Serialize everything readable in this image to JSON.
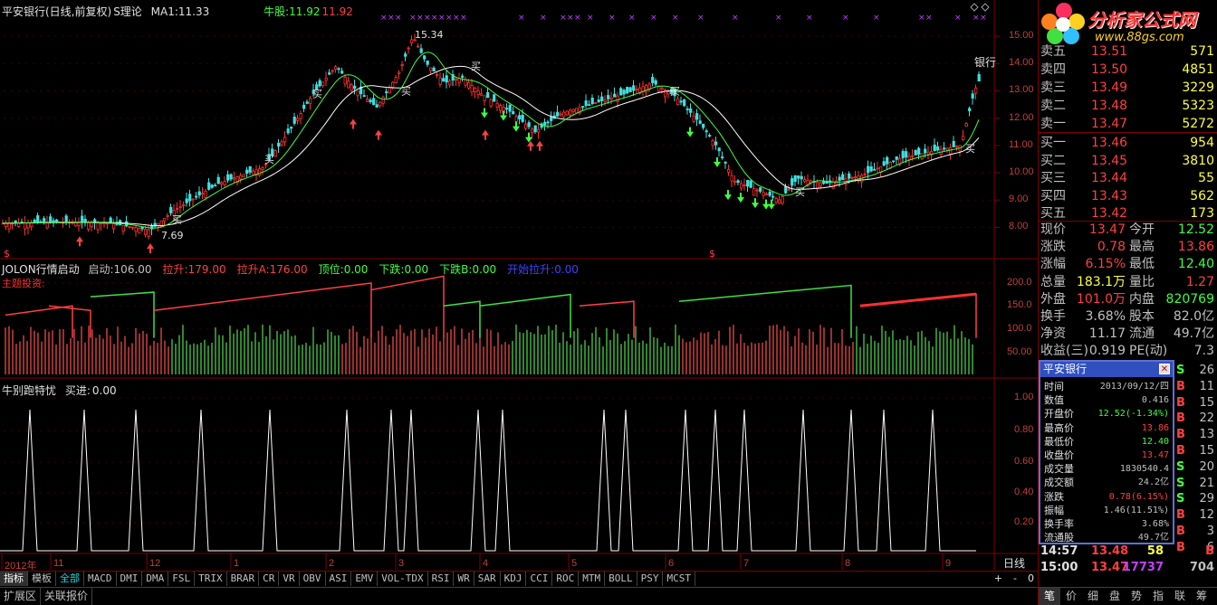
{
  "header": {
    "stock": "平安银行(日线,前复权)",
    "formula": "S理论",
    "ma_label": "MA1:",
    "ma_value": "11.33",
    "bull_label": "牛股:",
    "bull_v1": "11.92",
    "bull_v2": "11.92"
  },
  "price_axis": [
    "15.00",
    "14.00",
    "13.00",
    "12.00",
    "11.00",
    "10.00",
    "9.00",
    "8.00"
  ],
  "price_annotations": {
    "high": "15.34",
    "low": "7.69",
    "side": "银行",
    "buy": "买"
  },
  "indicator1": {
    "title": "JOLON行情启动",
    "items": [
      {
        "label": "启动:",
        "value": "106.00",
        "color": "#c0c0c0"
      },
      {
        "label": "拉升:",
        "value": "179.00",
        "color": "#ff4040"
      },
      {
        "label": "拉升A:",
        "value": "176.00",
        "color": "#ff4040"
      },
      {
        "label": "顶位:",
        "value": "0.00",
        "color": "#40ff40"
      },
      {
        "label": "下跌:",
        "value": "0.00",
        "color": "#40ff40"
      },
      {
        "label": "下跌B:",
        "value": "0.00",
        "color": "#40ff40"
      },
      {
        "label": "开始拉升:",
        "value": "0.00",
        "color": "#4040ff"
      }
    ],
    "sub": "主题投资:",
    "axis": [
      "200.0",
      "150.0",
      "100.0",
      "50.00"
    ]
  },
  "indicator2": {
    "title": "牛别跑特忧",
    "item_label": "买进:",
    "item_value": "0.00",
    "axis": [
      "1.00",
      "0.80",
      "0.60",
      "0.40",
      "0.20"
    ]
  },
  "dates": [
    "2012年",
    "11",
    "12",
    "1",
    "2",
    "3",
    "4",
    "5",
    "6",
    "7",
    "8",
    "9"
  ],
  "period": "日线",
  "zoom": {
    "plus": "+",
    "minus": "-",
    "zero": "0"
  },
  "tabs": [
    "指标",
    "模板",
    "全部",
    "MACD",
    "DMI",
    "DMA",
    "FSL",
    "TRIX",
    "BRAR",
    "CR",
    "VR",
    "OBV",
    "ASI",
    "EMV",
    "VOL-TDX",
    "RSI",
    "WR",
    "SAR",
    "KDJ",
    "CCI",
    "ROC",
    "MTM",
    "BOLL",
    "PSY",
    "MCST"
  ],
  "bottom_tabs": [
    "扩展区",
    "关联报价"
  ],
  "logo": {
    "text": "分析家公式网",
    "url": "www.88gs.com"
  },
  "sell_orders": [
    {
      "label": "卖五",
      "price": "13.51",
      "vol": "571"
    },
    {
      "label": "卖四",
      "price": "13.50",
      "vol": "4851"
    },
    {
      "label": "卖三",
      "price": "13.49",
      "vol": "3229"
    },
    {
      "label": "卖二",
      "price": "13.48",
      "vol": "5323"
    },
    {
      "label": "卖一",
      "price": "13.47",
      "vol": "5272"
    }
  ],
  "buy_orders": [
    {
      "label": "买一",
      "price": "13.46",
      "vol": "954"
    },
    {
      "label": "买二",
      "price": "13.45",
      "vol": "3810"
    },
    {
      "label": "买三",
      "price": "13.44",
      "vol": "55"
    },
    {
      "label": "买四",
      "price": "13.43",
      "vol": "562"
    },
    {
      "label": "买五",
      "price": "13.42",
      "vol": "173"
    }
  ],
  "quote": [
    {
      "l1": "现价",
      "v1": "13.47",
      "c1": "#ff4040",
      "l2": "今开",
      "v2": "12.52",
      "c2": "#40ff40"
    },
    {
      "l1": "涨跌",
      "v1": "0.78",
      "c1": "#ff4040",
      "l2": "最高",
      "v2": "13.86",
      "c2": "#ff4040"
    },
    {
      "l1": "涨幅",
      "v1": "6.15%",
      "c1": "#ff4040",
      "l2": "最低",
      "v2": "12.40",
      "c2": "#40ff40"
    },
    {
      "l1": "总量",
      "v1": "183.1万",
      "c1": "#ffff40",
      "l2": "量比",
      "v2": "1.27",
      "c2": "#ff4040"
    },
    {
      "l1": "外盘",
      "v1": "101.0万",
      "c1": "#ff4040",
      "l2": "内盘",
      "v2": "820769",
      "c2": "#40ff40"
    },
    {
      "l1": "换手",
      "v1": "3.68%",
      "c1": "#c0c0c0",
      "l2": "股本",
      "v2": "82.0亿",
      "c2": "#c0c0c0"
    },
    {
      "l1": "净资",
      "v1": "11.17",
      "c1": "#c0c0c0",
      "l2": "流通",
      "v2": "49.7亿",
      "c2": "#c0c0c0"
    },
    {
      "l1": "收益(三)",
      "v1": "0.919",
      "c1": "#c0c0c0",
      "l2": "PE(动)",
      "v2": "7.3",
      "c2": "#c0c0c0"
    }
  ],
  "ticks_sb": [
    {
      "s": "S",
      "n": "26",
      "c": "#40ff40"
    },
    {
      "s": "B",
      "n": "11",
      "c": "#ff4040"
    },
    {
      "s": "B",
      "n": "15",
      "c": "#ff4040"
    },
    {
      "s": "B",
      "n": "22",
      "c": "#ff4040"
    },
    {
      "s": "B",
      "n": "13",
      "c": "#ff4040"
    },
    {
      "s": "B",
      "n": "15",
      "c": "#ff4040"
    },
    {
      "s": "S",
      "n": "20",
      "c": "#40ff40"
    },
    {
      "s": "S",
      "n": "21",
      "c": "#40ff40"
    },
    {
      "s": "S",
      "n": "29",
      "c": "#40ff40"
    },
    {
      "s": "B",
      "n": "12",
      "c": "#ff4040"
    },
    {
      "s": "B",
      "n": "3",
      "c": "#ff4040"
    },
    {
      "s": "B",
      "n": "6",
      "c": "#ff4040"
    }
  ],
  "popup": {
    "title": "平安银行",
    "rows": [
      {
        "l": "时间",
        "v": "2013/09/12/四",
        "c": "#c0c0c0"
      },
      {
        "l": "数值",
        "v": "0.416",
        "c": "#c0c0c0"
      },
      {
        "l": "开盘价",
        "v": "12.52(-1.34%)",
        "c": "#40ff40"
      },
      {
        "l": "最高价",
        "v": "13.86",
        "c": "#ff4040"
      },
      {
        "l": "最低价",
        "v": "12.40",
        "c": "#40ff40"
      },
      {
        "l": "收盘价",
        "v": "13.47",
        "c": "#ff4040"
      },
      {
        "l": "成交量",
        "v": "1830540.4",
        "c": "#c0c0c0"
      },
      {
        "l": "成交额",
        "v": "24.2亿",
        "c": "#c0c0c0"
      },
      {
        "l": "涨跌",
        "v": "0.78(6.15%)",
        "c": "#ff4040"
      },
      {
        "l": "振幅",
        "v": "1.46(11.51%)",
        "c": "#c0c0c0"
      },
      {
        "l": "换手率",
        "v": "3.68%",
        "c": "#c0c0c0"
      },
      {
        "l": "流通股",
        "v": "49.7亿",
        "c": "#c0c0c0"
      }
    ]
  },
  "last_ticks": [
    {
      "time": "14:57",
      "price": "13.48",
      "vol": "58",
      "vc": "#ffff40",
      "extra": "B"
    },
    {
      "time": "15:00",
      "price": "13.47",
      "vol": "17737",
      "vc": "#c040ff",
      "extra": "704"
    }
  ],
  "nav": [
    "笔",
    "价",
    "细",
    "盘",
    "势",
    "指",
    "联",
    "筹"
  ]
}
